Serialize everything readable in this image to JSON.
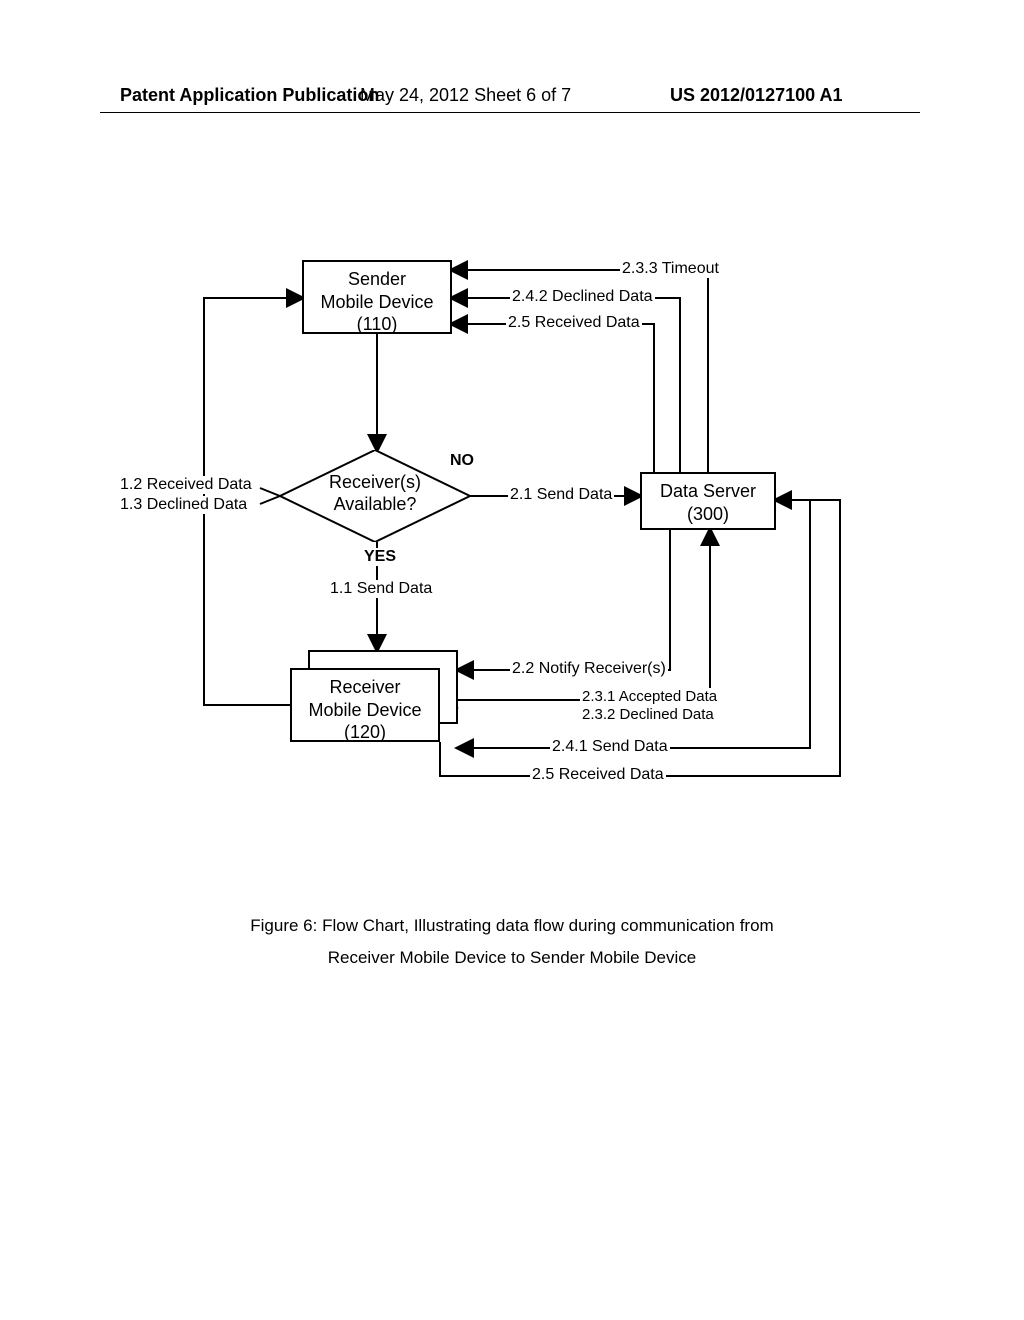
{
  "header": {
    "left": "Patent Application Publication",
    "mid": "May 24, 2012  Sheet 6 of 7",
    "right": "US 2012/0127100 A1"
  },
  "boxes": {
    "sender_l1": "Sender",
    "sender_l2": "Mobile Device",
    "sender_l3": "(110)",
    "decision_l1": "Receiver(s)",
    "decision_l2": "Available?",
    "server_l1": "Data Server",
    "server_l2": "(300)",
    "receiver_l1": "Receiver",
    "receiver_l2": "Mobile Device",
    "receiver_l3": "(120)"
  },
  "labels": {
    "no": "NO",
    "yes": "YES",
    "l12": "1.2 Received Data",
    "l13": "1.3 Declined Data",
    "l11": "1.1 Send Data",
    "l21": "2.1 Send Data",
    "l22": "2.2 Notify Receiver(s)",
    "l231": "2.3.1 Accepted Data",
    "l232": "2.3.2 Declined Data",
    "l233": "2.3.3 Timeout",
    "l241": "2.4.1 Send Data",
    "l242": "2.4.2 Declined Data",
    "l25a": "2.5 Received Data",
    "l25b": "2.5  Received Data"
  },
  "caption": {
    "l1": "Figure 6: Flow Chart, Illustrating data flow  during communication from",
    "l2": "Receiver Mobile Device to Sender  Mobile Device"
  }
}
